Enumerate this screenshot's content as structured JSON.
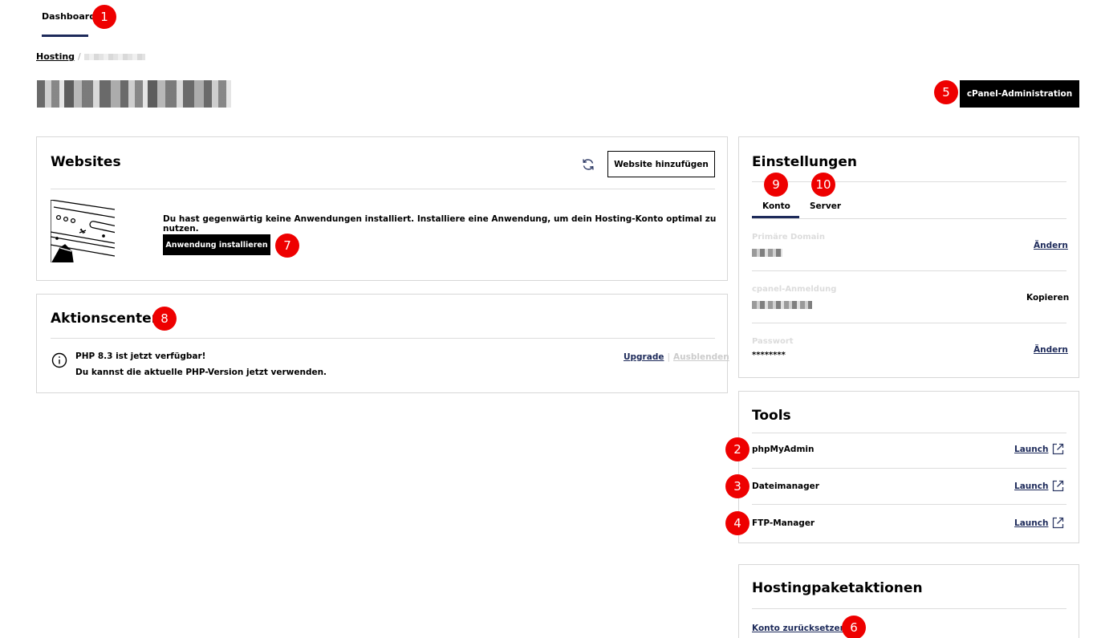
{
  "nav": {
    "dashboard_tab": "Dashboard"
  },
  "breadcrumb": {
    "root": "Hosting",
    "separator": "/"
  },
  "header": {
    "cpanel_button": "cPanel-Administration"
  },
  "websites": {
    "title": "Websites",
    "add_button": "Website hinzufügen",
    "empty_message": "Du hast gegenwärtig keine Anwendungen installiert. Installiere eine Anwendung, um dein Hosting-Konto optimal zu nutzen.",
    "install_button": "Anwendung installieren"
  },
  "action_center": {
    "title": "Aktionscenter",
    "notice_title": "PHP 8.3 ist jetzt verfügbar!",
    "notice_body": "Du kannst die aktuelle PHP-Version jetzt verwenden.",
    "upgrade_link": "Upgrade",
    "link_separator": "|",
    "hide_link": "Ausblenden"
  },
  "settings": {
    "title": "Einstellungen",
    "tabs": [
      {
        "label": "Konto"
      },
      {
        "label": "Server"
      }
    ],
    "fields": [
      {
        "label": "Primäre Domain",
        "action": "Ändern"
      },
      {
        "label": "cpanel-Anmeldung",
        "action": "Kopieren"
      },
      {
        "label": "Passwort",
        "value": "********",
        "action": "Ändern"
      }
    ]
  },
  "tools": {
    "title": "Tools",
    "items": [
      {
        "name": "phpMyAdmin",
        "action": "Launch"
      },
      {
        "name": "Dateimanager",
        "action": "Launch"
      },
      {
        "name": "FTP-Manager",
        "action": "Launch"
      }
    ]
  },
  "package_actions": {
    "title": "Hostingpaketaktionen",
    "reset_link": "Konto zurücksetzen"
  },
  "markers": [
    "1",
    "2",
    "3",
    "4",
    "5",
    "6",
    "7",
    "8",
    "9",
    "10"
  ],
  "colors": {
    "marker": "#ee0000",
    "link": "#1d2a5a",
    "tab_underline": "#1d2a5a",
    "button": "#000000"
  }
}
